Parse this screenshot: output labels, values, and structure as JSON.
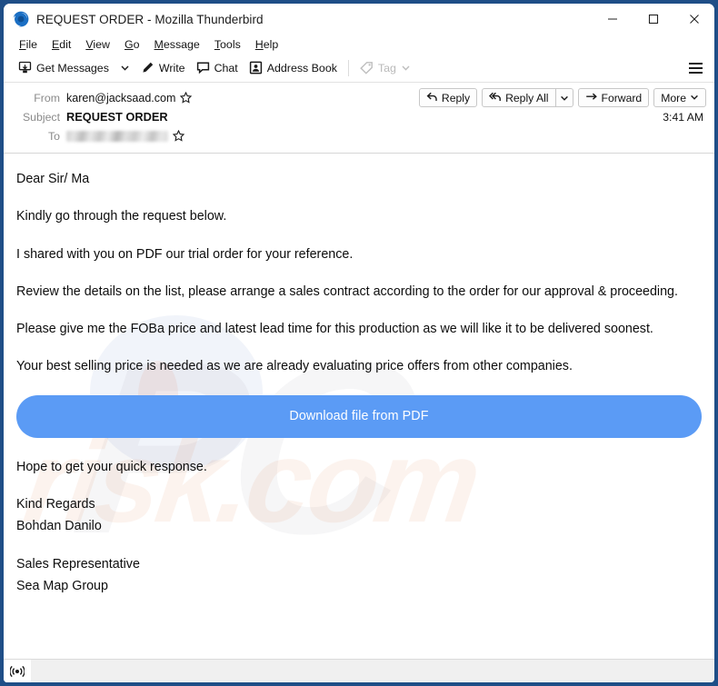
{
  "window": {
    "title": "REQUEST ORDER - Mozilla Thunderbird",
    "logo_icon": "thunderbird-logo-icon",
    "controls": {
      "minimize": "minimize-icon",
      "maximize": "maximize-icon",
      "close": "close-icon"
    }
  },
  "menubar": {
    "items": [
      {
        "label": "File",
        "accel": "F"
      },
      {
        "label": "Edit",
        "accel": "E"
      },
      {
        "label": "View",
        "accel": "V"
      },
      {
        "label": "Go",
        "accel": "G"
      },
      {
        "label": "Message",
        "accel": "M"
      },
      {
        "label": "Tools",
        "accel": "T"
      },
      {
        "label": "Help",
        "accel": "H"
      }
    ]
  },
  "toolbar": {
    "get_messages_label": "Get Messages",
    "get_messages_icon": "get-messages-icon",
    "get_messages_chevron": "chevron-down-icon",
    "write_label": "Write",
    "write_icon": "pencil-icon",
    "chat_label": "Chat",
    "chat_icon": "chat-bubble-icon",
    "address_book_label": "Address Book",
    "address_book_icon": "address-book-icon",
    "tag_label": "Tag",
    "tag_icon": "tag-icon",
    "tag_chevron": "chevron-down-icon",
    "tag_disabled": true,
    "app_menu_icon": "hamburger-menu-icon"
  },
  "message_header": {
    "from_label": "From",
    "from_value": "karen@jacksaad.com",
    "from_star_icon": "star-icon",
    "subject_label": "Subject",
    "subject_value": "REQUEST ORDER",
    "to_label": "To",
    "to_value": "",
    "to_redacted": true,
    "to_star_icon": "star-icon",
    "time": "3:41 AM",
    "actions": {
      "reply_label": "Reply",
      "reply_icon": "reply-arrow-icon",
      "reply_all_label": "Reply All",
      "reply_all_icon": "reply-all-arrow-icon",
      "reply_all_chevron": "chevron-down-icon",
      "forward_label": "Forward",
      "forward_icon": "forward-arrow-icon",
      "more_label": "More",
      "more_chevron": "chevron-down-icon"
    }
  },
  "message_body": {
    "greeting": "Dear Sir/ Ma",
    "paragraph_1": "Kindly go through the request below.",
    "paragraph_2": "I shared with you on  PDF our trial order for your reference.",
    "paragraph_3": "Review the details on the list, please arrange a sales contract according to the order for our approval & proceeding.",
    "paragraph_4": "Please give me the FOBa price and latest lead time for this production as we will like it to be delivered soonest.",
    "paragraph_5": "Your best selling price is needed as we are already evaluating price offers from other companies.",
    "download_button_label": "Download file from PDF",
    "download_button_color": "#5b9bf5",
    "closing": "Hope to get your quick response.",
    "sign_off": "Kind Regards",
    "sender_name": "Bohdan Danilo",
    "sender_title": "Sales Representative",
    "sender_company": "Sea Map Group",
    "watermark_1": "PC",
    "watermark_2": "risk.com"
  },
  "statusbar": {
    "connection_icon": "broadcast-online-icon",
    "text": ""
  },
  "colors": {
    "window_border": "#1f4e87",
    "accent_blue": "#5b9bf5",
    "label_gray": "#8a8a8a"
  }
}
